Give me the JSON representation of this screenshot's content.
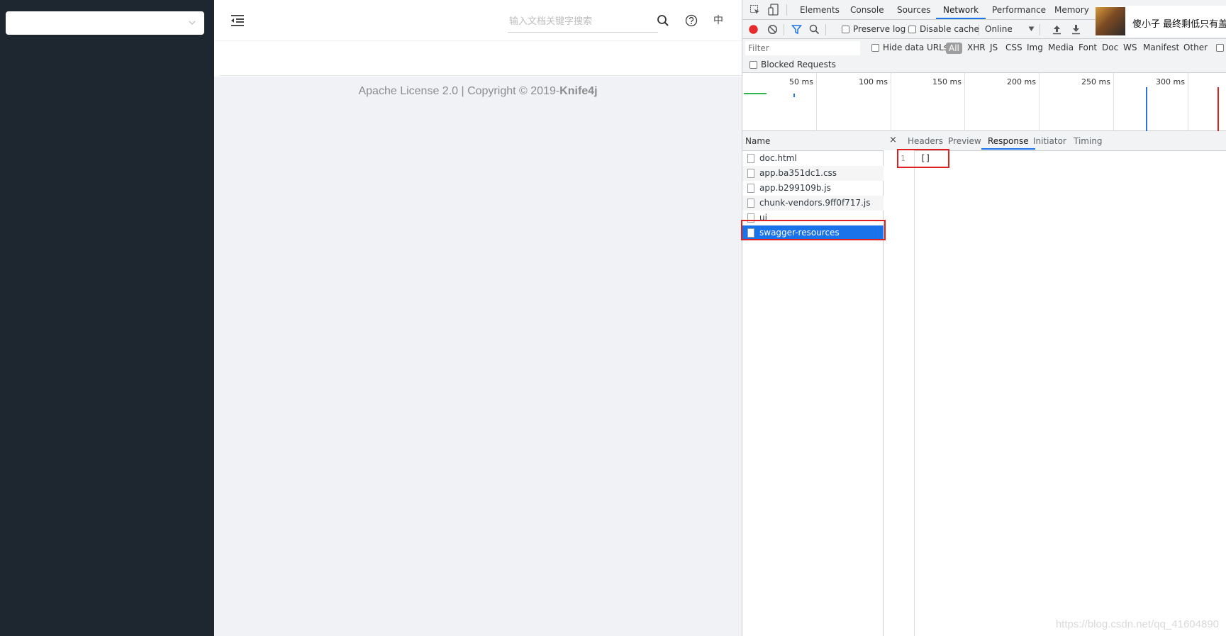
{
  "app": {
    "search_placeholder": "输入文档关键字搜索",
    "lang_label": "中",
    "footer": {
      "prefix": "Apache License 2.0 | Copyright ",
      "copyright_symbol": "©",
      "year": " 2019-",
      "brand": "Knife4j"
    }
  },
  "devtools": {
    "tabs": [
      "Elements",
      "Console",
      "Sources",
      "Network",
      "Performance",
      "Memory"
    ],
    "active_tab": "Network",
    "toolbar": {
      "preserve_log": "Preserve log",
      "disable_cache": "Disable cache",
      "throttle": "Online"
    },
    "filter": {
      "placeholder": "Filter",
      "hide_data_urls": "Hide data URLs",
      "types": [
        "All",
        "XHR",
        "JS",
        "CSS",
        "Img",
        "Media",
        "Font",
        "Doc",
        "WS",
        "Manifest",
        "Other"
      ]
    },
    "blocked_requests": "Blocked Requests",
    "timeline_ticks": [
      "50 ms",
      "100 ms",
      "150 ms",
      "200 ms",
      "250 ms",
      "300 ms"
    ],
    "name_header": "Name",
    "requests": [
      "doc.html",
      "app.ba351dc1.css",
      "app.b299109b.js",
      "chunk-vendors.9ff0f717.js",
      "ui",
      "swagger-resources"
    ],
    "selected_request": "swagger-resources",
    "detail": {
      "close": "×",
      "tabs": [
        "Headers",
        "Preview",
        "Response",
        "Initiator",
        "Timing"
      ],
      "active_tab": "Response",
      "line_number": "1",
      "response_body": "[]"
    }
  },
  "notification": {
    "text": "傻小子 最终剩低只有盖耻"
  },
  "watermark": "https://blog.csdn.net/qq_41604890",
  "colors": {
    "sidebar": "#1e2630",
    "accent": "#1a73e8",
    "highlight": "#e02020",
    "record": "#e52b2b"
  }
}
